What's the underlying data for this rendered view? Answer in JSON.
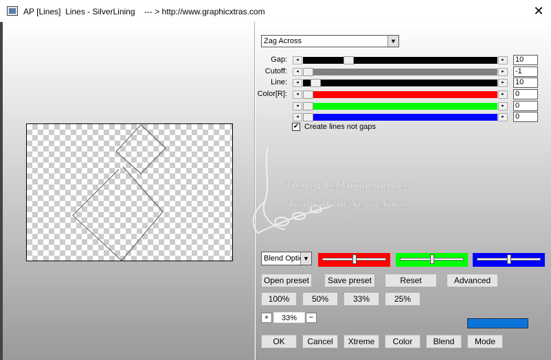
{
  "window": {
    "title": "AP [Lines]  Lines - SilverLining    --- > http://www.graphicxtras.com",
    "close_glyph": "✕"
  },
  "mode_dropdown": {
    "value": "Zag Across",
    "arrow": "▼"
  },
  "sliders": [
    {
      "label": "Gap:",
      "value": "10",
      "track_color": "#000000",
      "thumb_fraction": 0.22
    },
    {
      "label": "Cutoff:",
      "value": "-1",
      "track_color": "#808080",
      "thumb_fraction": 0.0
    },
    {
      "label": "Line:",
      "value": "10",
      "track_color": "#000000",
      "thumb_fraction": 0.04
    },
    {
      "label": "Color[R]:",
      "value": "0",
      "track_color": "#ff0000",
      "thumb_fraction": 0.0
    },
    {
      "label": "",
      "value": "0",
      "track_color": "#00ff00",
      "thumb_fraction": 0.0
    },
    {
      "label": "",
      "value": "0",
      "track_color": "#0000ff",
      "thumb_fraction": 0.0
    }
  ],
  "scroll_arrows": {
    "left": "◂",
    "right": "▸"
  },
  "checkbox": {
    "checked_glyph": "✔",
    "label": "Create lines not gaps"
  },
  "watermark": {
    "line1": "Tuto by Le Monde de Bea",
    "line2": "Traduzido by Nesra Novas"
  },
  "blend": {
    "value": "Blend Optio",
    "arrow": "▼"
  },
  "color_sliders": [
    {
      "name": "red",
      "color": "#ff0000",
      "level": 0.5
    },
    {
      "name": "green",
      "color": "#00ff00",
      "level": 0.5
    },
    {
      "name": "blue",
      "color": "#0000ff",
      "level": 0.5
    }
  ],
  "preset_buttons": [
    "Open preset",
    "Save preset",
    "Reset",
    "Advanced"
  ],
  "zoom_buttons": [
    "100%",
    "50%",
    "33%",
    "25%"
  ],
  "zoom": {
    "plus": "+",
    "value": "33%",
    "minus": "−"
  },
  "current_color": "#0a74d9",
  "bottom_buttons": [
    "OK",
    "Cancel",
    "Xtreme",
    "Color",
    "Blend",
    "Mode"
  ]
}
